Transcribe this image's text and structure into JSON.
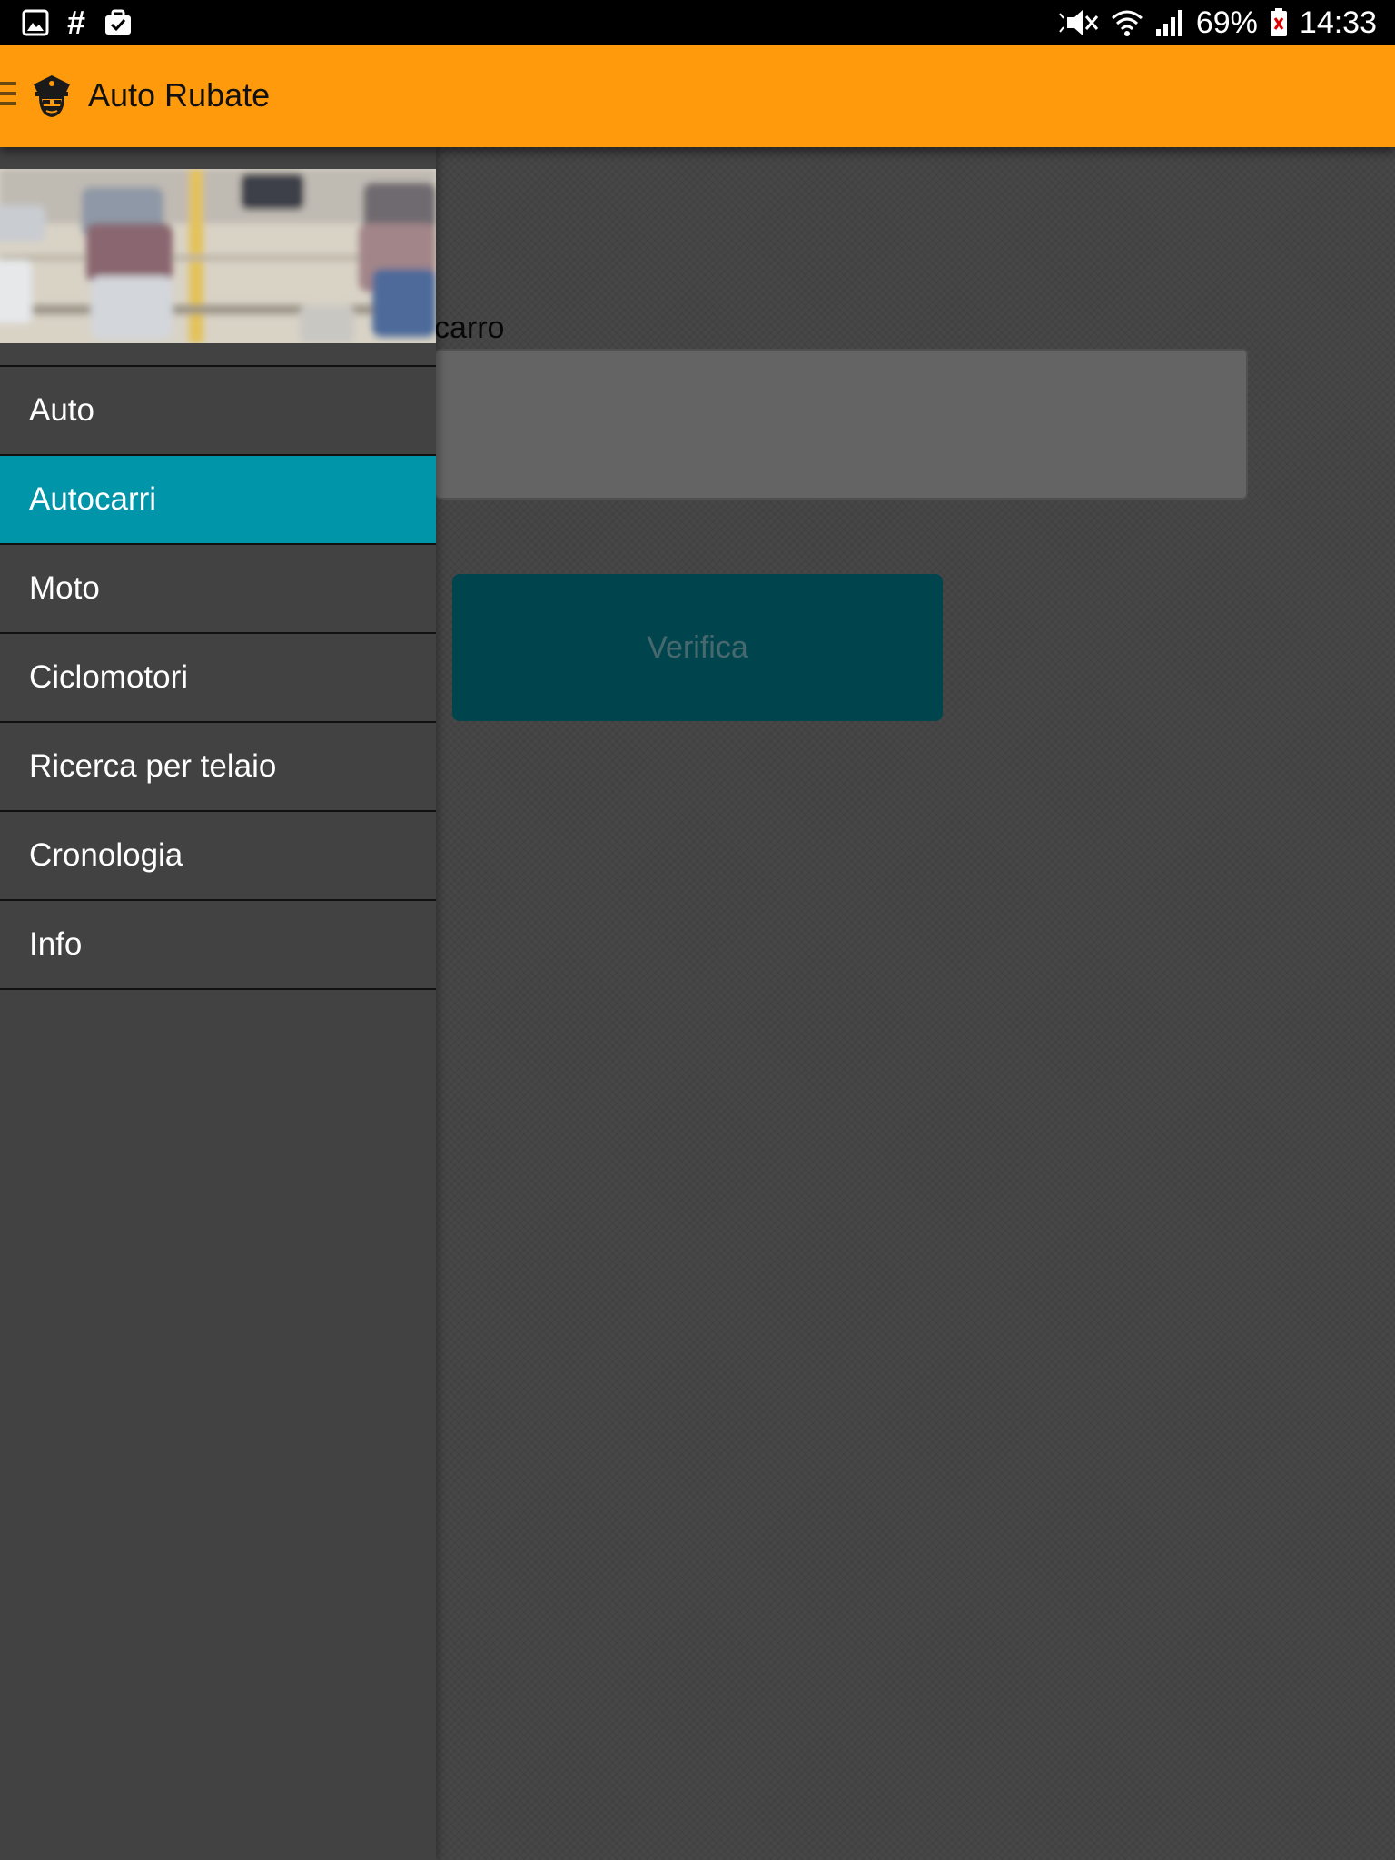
{
  "status_bar": {
    "icons_left": [
      "image-icon",
      "hash-icon",
      "briefcase-check-icon"
    ],
    "hash_glyph": "#",
    "icons_right": [
      "mute-icon",
      "wifi-icon",
      "signal-icon",
      "battery-icon"
    ],
    "battery": "69%",
    "time": "14:33"
  },
  "app_bar": {
    "title": "Auto Rubate",
    "color": "#ff9a0d",
    "logo": "police-officer-icon"
  },
  "drawer": {
    "header_image": "parking-lot-cars-photo",
    "items": [
      {
        "label": "Auto",
        "active": false
      },
      {
        "label": "Autocarri",
        "active": true
      },
      {
        "label": "Moto",
        "active": false
      },
      {
        "label": "Ciclomotori",
        "active": false
      },
      {
        "label": "Ricerca per telaio",
        "active": false
      },
      {
        "label": "Cronologia",
        "active": false
      },
      {
        "label": "Info",
        "active": false
      }
    ],
    "active_color": "#0095a8"
  },
  "main": {
    "field_label_visible": "carro",
    "input_value": "",
    "verify_button_label": "Verifica",
    "button_color": "#008b9c"
  }
}
